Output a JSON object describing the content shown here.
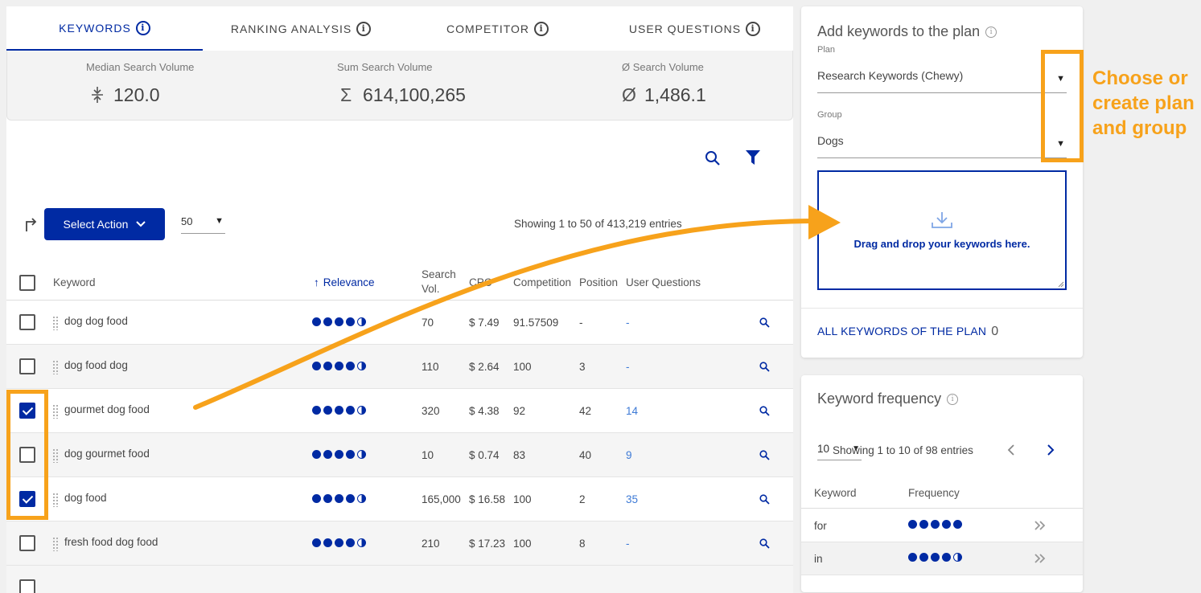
{
  "tabs": [
    {
      "label": "KEYWORDS",
      "active": true
    },
    {
      "label": "RANKING ANALYSIS",
      "active": false
    },
    {
      "label": "COMPETITOR",
      "active": false
    },
    {
      "label": "USER QUESTIONS",
      "active": false
    }
  ],
  "stats": [
    {
      "label": "Median Search Volume",
      "symbol": "⩐",
      "value": "120.0"
    },
    {
      "label": "Sum Search Volume",
      "symbol": "Σ",
      "value": "614,100,265"
    },
    {
      "label": "Ø Search Volume",
      "symbol": "Ø",
      "value": "1,486.1"
    }
  ],
  "toolbar": {
    "select_action": "Select Action",
    "per_page": "50",
    "showing": "Showing 1 to 50 of 413,219 entries"
  },
  "table": {
    "headers": {
      "keyword": "Keyword",
      "relevance": "Relevance",
      "search_vol_1": "Search",
      "search_vol_2": "Vol.",
      "cpc": "CPC",
      "competition": "Competition",
      "position": "Position",
      "user_questions": "User Questions"
    },
    "rows": [
      {
        "checked": false,
        "keyword": "dog dog food",
        "relevance": 4.5,
        "search_vol": "70",
        "cpc": "$ 7.49",
        "competition": "91.57509",
        "position": "-",
        "user_questions": "-"
      },
      {
        "checked": false,
        "keyword": "dog food dog",
        "relevance": 4.5,
        "search_vol": "110",
        "cpc": "$ 2.64",
        "competition": "100",
        "position": "3",
        "user_questions": "-"
      },
      {
        "checked": true,
        "keyword": "gourmet dog food",
        "relevance": 4.5,
        "search_vol": "320",
        "cpc": "$ 4.38",
        "competition": "92",
        "position": "42",
        "user_questions": "14"
      },
      {
        "checked": false,
        "keyword": "dog gourmet food",
        "relevance": 4.5,
        "search_vol": "10",
        "cpc": "$ 0.74",
        "competition": "83",
        "position": "40",
        "user_questions": "9"
      },
      {
        "checked": true,
        "keyword": "dog food",
        "relevance": 4.5,
        "search_vol": "165,000",
        "cpc": "$ 16.58",
        "competition": "100",
        "position": "2",
        "user_questions": "35"
      },
      {
        "checked": false,
        "keyword": "fresh food dog food",
        "relevance": 4.5,
        "search_vol": "210",
        "cpc": "$ 17.23",
        "competition": "100",
        "position": "8",
        "user_questions": "-"
      }
    ]
  },
  "plan_panel": {
    "title": "Add keywords to the plan",
    "plan_label": "Plan",
    "plan_value": "Research Keywords (Chewy)",
    "group_label": "Group",
    "group_value": "Dogs",
    "drop_text": "Drag and drop your keywords here.",
    "all_keywords_label": "ALL KEYWORDS OF THE PLAN",
    "all_keywords_count": "0"
  },
  "frequency_panel": {
    "title": "Keyword frequency",
    "per_page": "10",
    "showing": "Showing 1 to 10 of 98 entries",
    "headers": {
      "keyword": "Keyword",
      "frequency": "Frequency"
    },
    "rows": [
      {
        "keyword": "for",
        "frequency": 5
      },
      {
        "keyword": "in",
        "frequency": 4.5
      }
    ]
  },
  "annotation": {
    "text": "Choose or create plan and group",
    "color": "#f7a21b"
  },
  "colors": {
    "primary": "#002aa3",
    "link": "#3d7ad6",
    "annotation": "#f7a21b"
  }
}
